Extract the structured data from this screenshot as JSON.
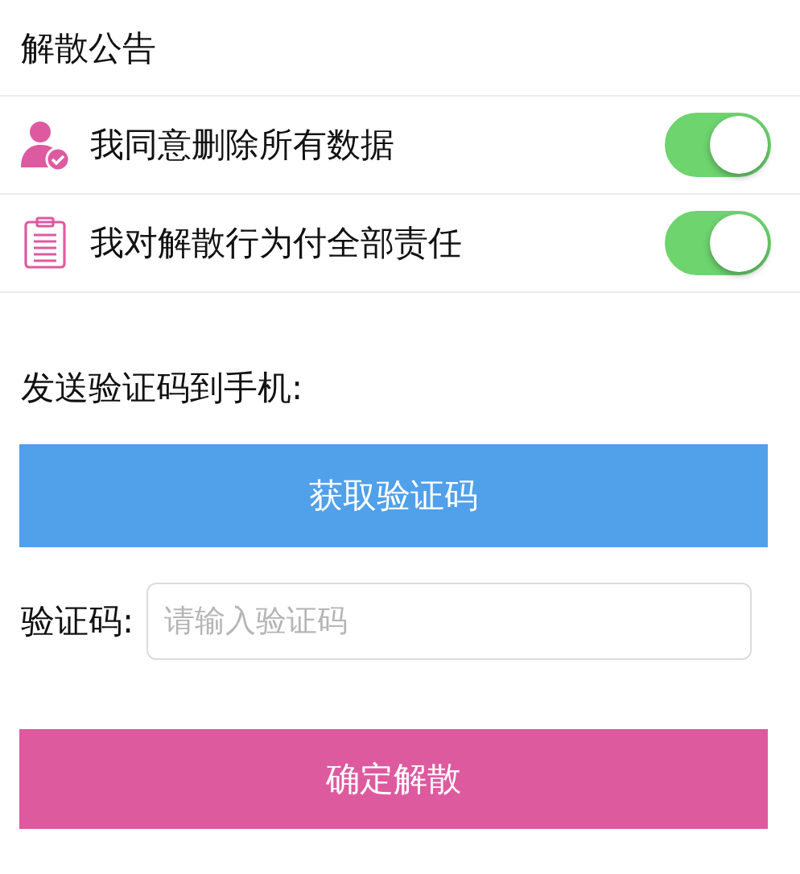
{
  "header": {
    "title": "解散公告"
  },
  "agreements": [
    {
      "label": "我同意删除所有数据",
      "on": true
    },
    {
      "label": "我对解散行为付全部责任",
      "on": true
    }
  ],
  "send_prompt": "发送验证码到手机:",
  "get_code_button": "获取验证码",
  "code_field": {
    "label": "验证码:",
    "placeholder": "请输入验证码"
  },
  "confirm_button": "确定解散"
}
